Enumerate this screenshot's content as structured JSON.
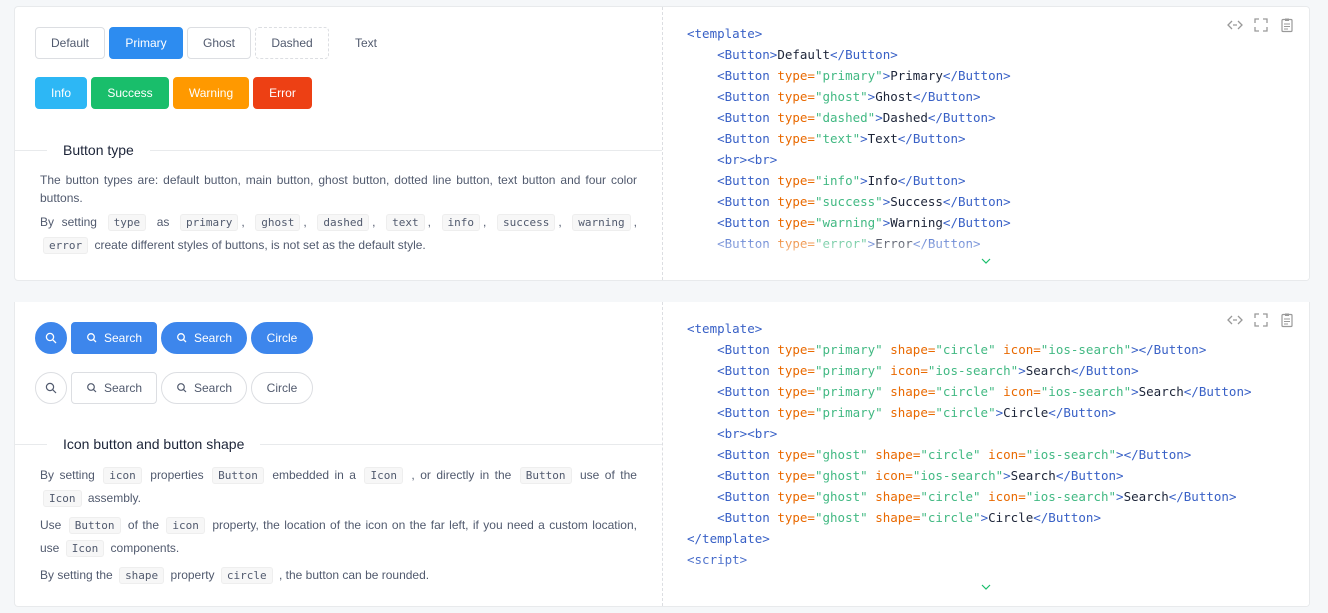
{
  "section1": {
    "buttons_row1": [
      "Default",
      "Primary",
      "Ghost",
      "Dashed",
      "Text"
    ],
    "buttons_row2": [
      "Info",
      "Success",
      "Warning",
      "Error"
    ],
    "title": "Button type",
    "desc1": "The button types are: default button, main button, ghost button, dotted line button, text button and four color buttons.",
    "desc2": {
      "by_setting": "By setting",
      "type": "type",
      "as": "as",
      "values": [
        "primary",
        "ghost",
        "dashed",
        "text",
        "info",
        "success",
        "warning",
        "error"
      ],
      "tail": "create different styles of buttons, is not set as the default style."
    }
  },
  "section2": {
    "primary_buttons": [
      "Search",
      "Search",
      "Circle"
    ],
    "ghost_buttons": [
      "Search",
      "Search",
      "Circle"
    ],
    "title": "Icon button and button shape",
    "d1": [
      "By setting",
      "icon",
      "properties",
      "Button",
      "embedded in a",
      "Icon",
      ", or directly in the",
      "Button",
      "use of the",
      "Icon",
      "assembly."
    ],
    "d2": [
      "Use",
      "Button",
      "of the",
      "icon",
      "property, the location of the icon on the far left, if you need a custom location, use",
      "Icon",
      "components."
    ],
    "d3": [
      "By setting the",
      "shape",
      "property",
      "circle",
      ", the button can be rounded."
    ]
  },
  "icons": {
    "search": "search-icon",
    "code": "code-icon",
    "fullscreen": "fullscreen-icon",
    "copy": "clipboard-icon",
    "expand": "chevron-down-icon"
  }
}
